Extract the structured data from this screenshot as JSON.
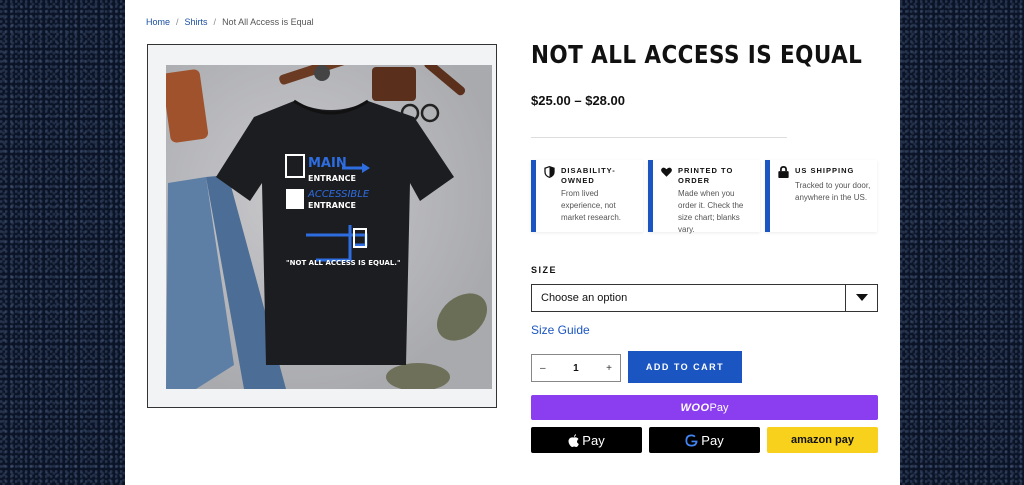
{
  "breadcrumb": {
    "home": "Home",
    "category": "Shirts",
    "current": "Not All Access is Equal",
    "separator": "/"
  },
  "product": {
    "title": "NOT ALL ACCESS IS EQUAL",
    "price": "$25.00 – $28.00",
    "shirt_text": {
      "main": "MAIN",
      "entrance1": "ENTRANCE",
      "accessible": "ACCESSIBLE",
      "entrance2": "ENTRANCE",
      "slogan": "\"NOT ALL ACCESS IS EQUAL.\""
    }
  },
  "features": [
    {
      "icon": "shield-icon",
      "title": "DISABILITY-OWNED",
      "desc": "From lived experience, not market research."
    },
    {
      "icon": "heart-icon",
      "title": "PRINTED TO ORDER",
      "desc": "Made when you order it. Check the size chart; blanks vary."
    },
    {
      "icon": "lock-icon",
      "title": "US SHIPPING",
      "desc": "Tracked to your door, anywhere in the US."
    }
  ],
  "size": {
    "label": "SIZE",
    "selected": "Choose an option",
    "guide": "Size Guide"
  },
  "quantity": {
    "minus": "–",
    "value": "1",
    "plus": "+"
  },
  "buttons": {
    "add_to_cart": "ADD TO CART",
    "woopay": "WOO",
    "woopay_suffix": "Pay",
    "apple_pay": "Pay",
    "google_pay": "Pay",
    "amazon_pay": "amazon pay"
  },
  "colors": {
    "accent": "#1b55c2",
    "woopay": "#8b3df0",
    "amazon": "#f7d11b"
  }
}
